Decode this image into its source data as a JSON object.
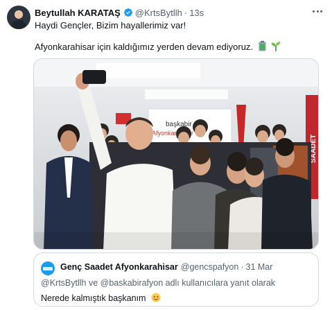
{
  "tweet": {
    "author_name": "Beytullah KARATAŞ",
    "author_handle": "@KrtsBytllh",
    "separator": "·",
    "time": "13s",
    "line1": "Haydi Gençler, Bizim hayallerimiz var!",
    "line2": "Afyonkarahisar için kaldığımız yerden devam ediyoruz.",
    "emojis": [
      "battery-icon",
      "seedling-icon"
    ],
    "verified_color": "#1d9bf0"
  },
  "photo": {
    "poster_text_top": "başkabir",
    "poster_text_bottom": "Afyonkarahisar",
    "banner_text": "SAADET"
  },
  "quote": {
    "author_name": "Genç Saadet Afyonkarahisar",
    "author_handle": "@gencspafyon",
    "separator": "·",
    "date": "31 Mar",
    "reply_line": "@KrtsBytllh ve @baskabirafyon adlı kullanıcılara yanıt olarak",
    "text": "Nerede kalmıştık başkanım",
    "emoji": "smiling-face-icon"
  },
  "colors": {
    "accent": "#1d9bf0",
    "secondary_text": "#536471",
    "border": "#cfd9de"
  }
}
